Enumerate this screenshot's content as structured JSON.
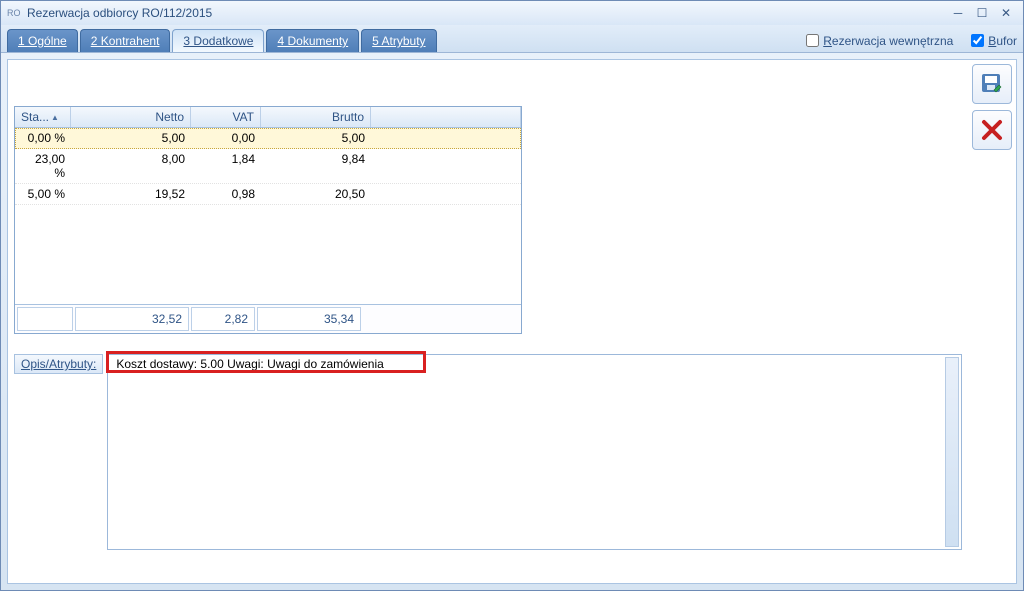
{
  "window": {
    "app_prefix": "RO",
    "title": "Rezerwacja odbiorcy RO/112/2015"
  },
  "tabs": [
    {
      "label": "1 Ogólne"
    },
    {
      "label": "2 Kontrahent"
    },
    {
      "label": "3 Dodatkowe",
      "active": true
    },
    {
      "label": "4 Dokumenty"
    },
    {
      "label": "5 Atrybuty"
    }
  ],
  "checkboxes": {
    "internal": {
      "label_prefix": "R",
      "label_rest": "ezerwacja wewnętrzna",
      "checked": false
    },
    "bufor": {
      "label_prefix": "B",
      "label_rest": "ufor",
      "checked": true
    }
  },
  "grid": {
    "headers": {
      "sta": "Sta...",
      "netto": "Netto",
      "vat": "VAT",
      "brutto": "Brutto"
    },
    "rows": [
      {
        "sta": "0,00  %",
        "netto": "5,00",
        "vat": "0,00",
        "brutto": "5,00",
        "selected": true
      },
      {
        "sta": "23,00 %",
        "netto": "8,00",
        "vat": "1,84",
        "brutto": "9,84"
      },
      {
        "sta": "5,00  %",
        "netto": "19,52",
        "vat": "0,98",
        "brutto": "20,50"
      }
    ],
    "footer": {
      "netto": "32,52",
      "vat": "2,82",
      "brutto": "35,34"
    }
  },
  "opis": {
    "label": "Opis/Atrybuty:",
    "text": "Koszt dostawy: 5.00 Uwagi: Uwagi do zamówienia"
  },
  "side_buttons": {
    "save": "save",
    "cancel": "cancel"
  }
}
